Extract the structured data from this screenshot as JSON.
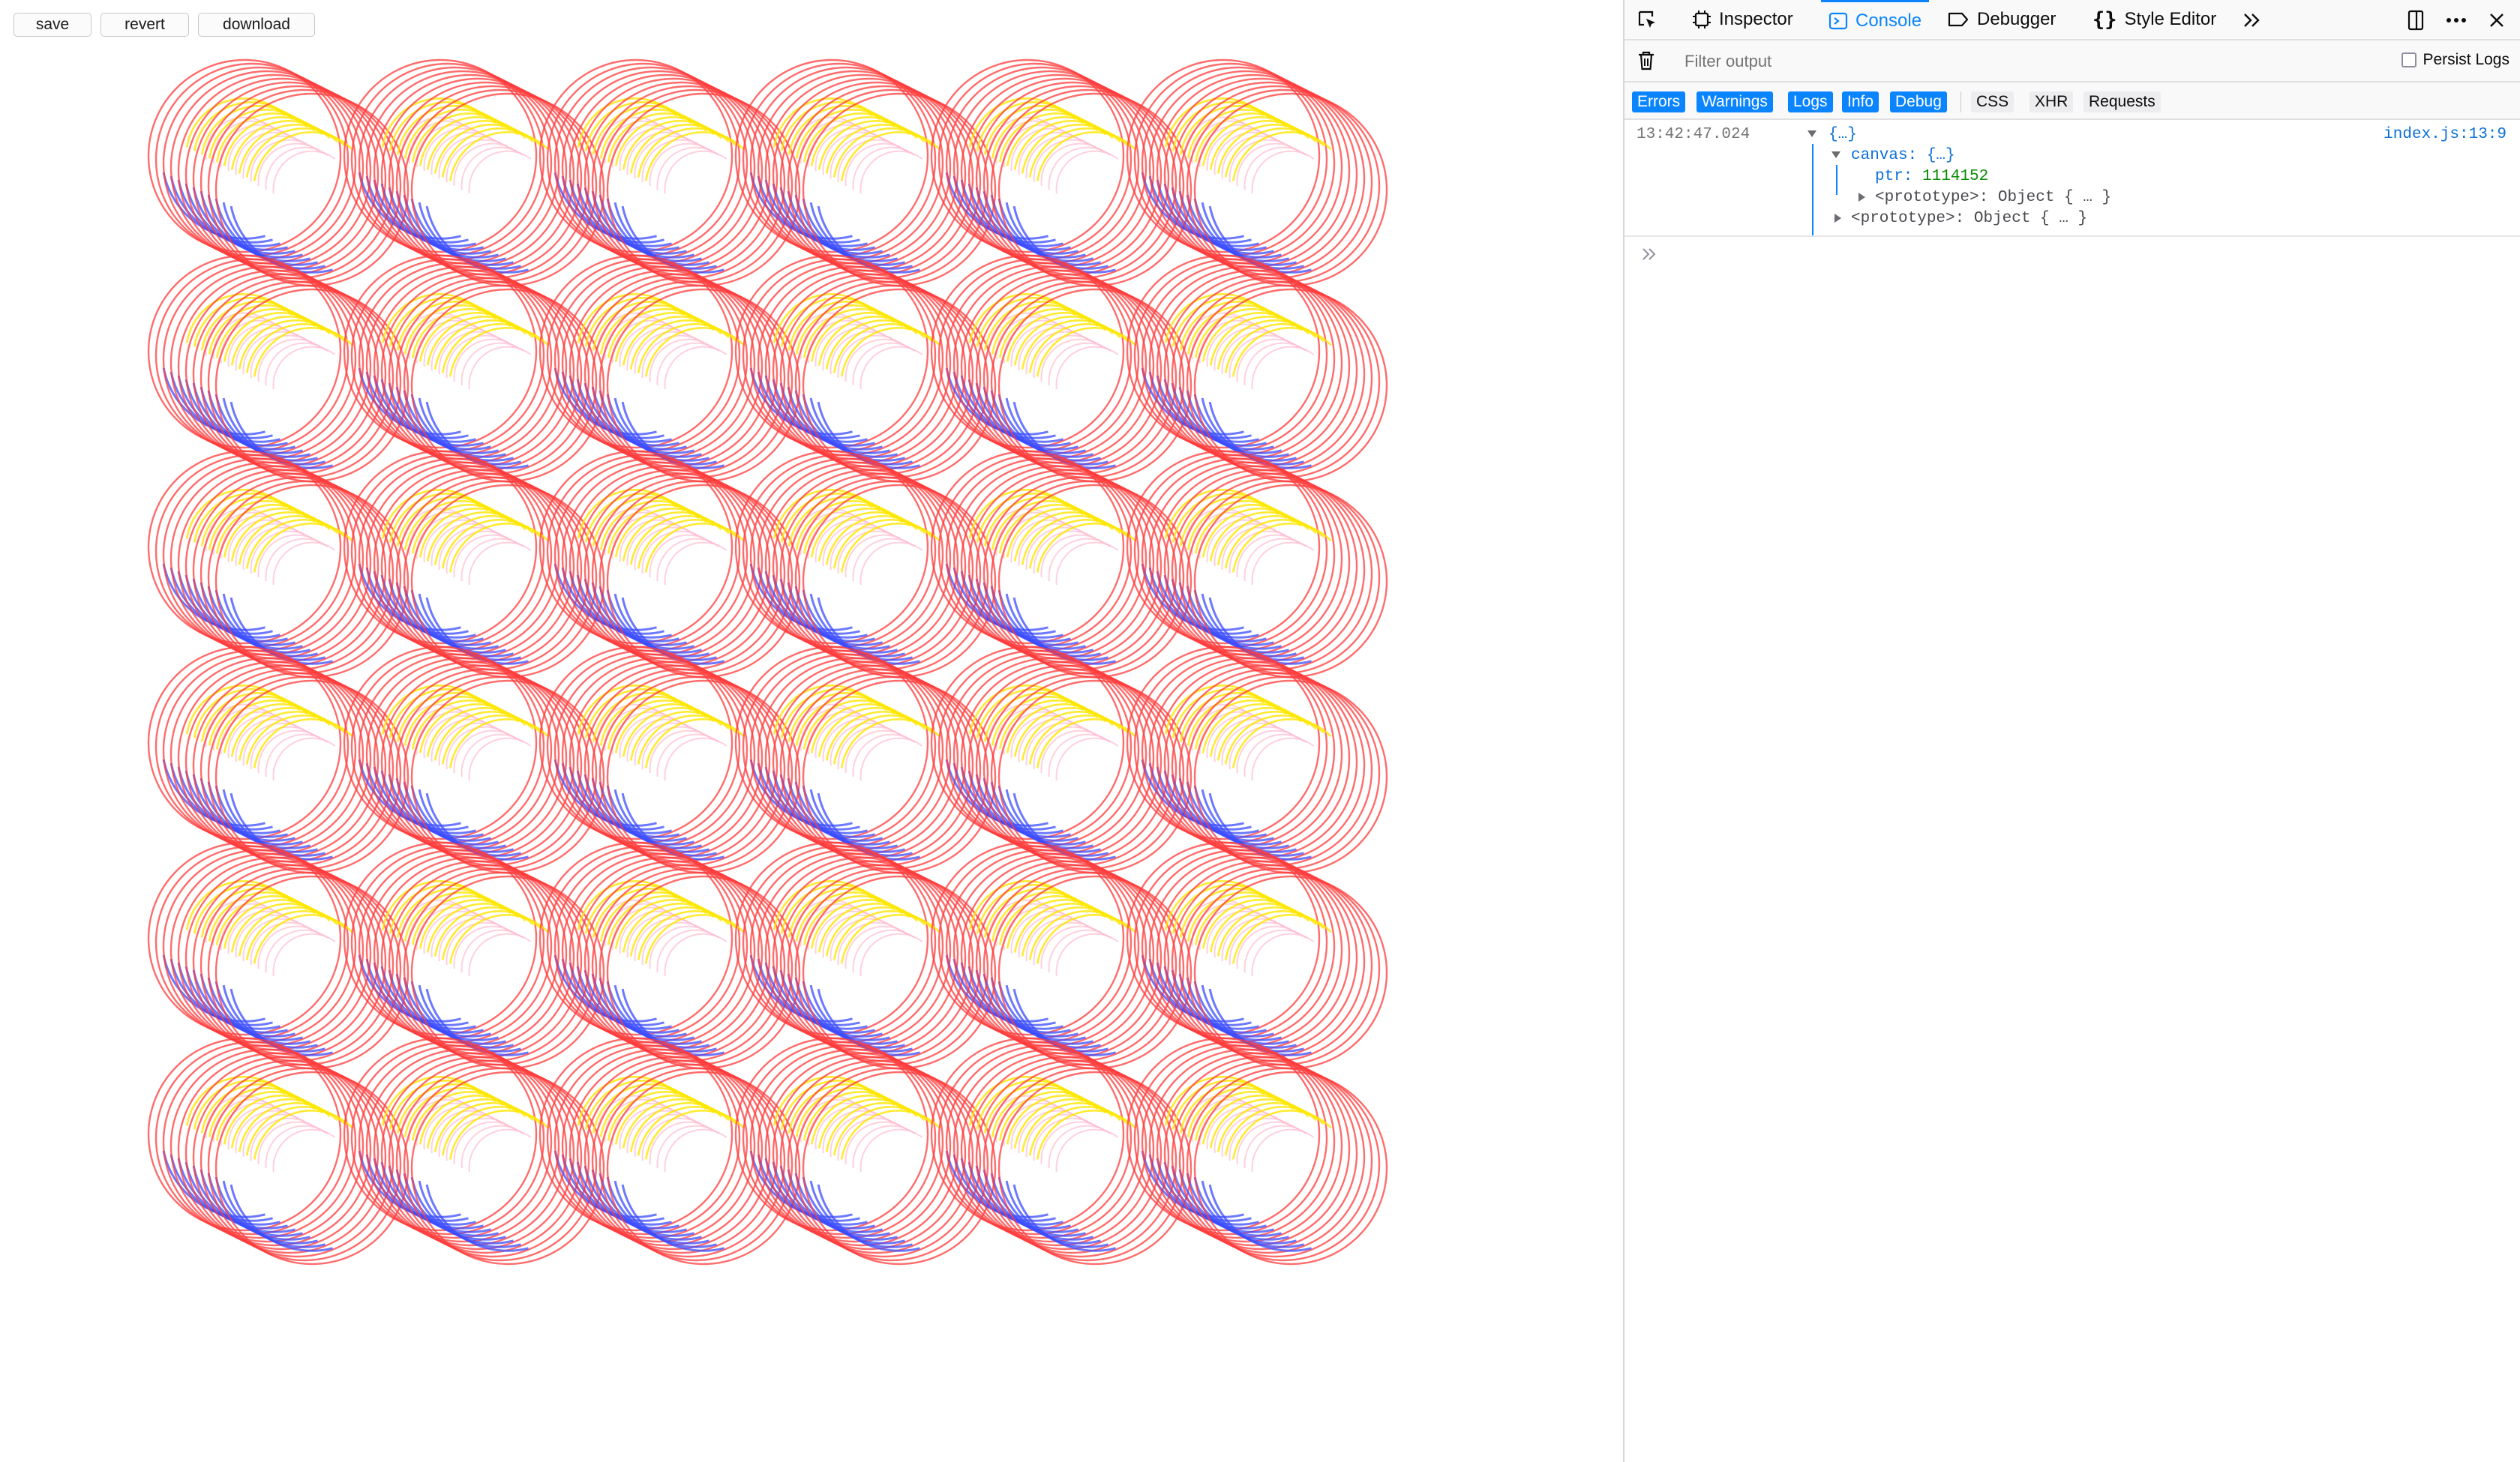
{
  "page": {
    "buttons": {
      "save": "save",
      "revert": "revert",
      "download": "download"
    },
    "artwork": {
      "grid_rows": 6,
      "grid_cols": 6,
      "rings_per_tile": 10,
      "colors": {
        "ring": "#ff3b3b",
        "arc_blue": "#3b4cff",
        "arc_yellow": "#ffe600",
        "arc_pink": "#ffb0c8"
      }
    }
  },
  "devtools": {
    "tabs": [
      {
        "label": "Inspector",
        "icon": "inspector-icon"
      },
      {
        "label": "Console",
        "icon": "console-icon"
      },
      {
        "label": "Debugger",
        "icon": "debugger-icon"
      },
      {
        "label": "Style Editor",
        "icon": "style-editor-icon"
      }
    ],
    "filter": {
      "placeholder": "Filter output",
      "persist_logs": "Persist Logs"
    },
    "levels": [
      "Errors",
      "Warnings",
      "Logs",
      "Info",
      "Debug"
    ],
    "types": [
      "CSS",
      "XHR",
      "Requests"
    ],
    "log": {
      "timestamp": "13:42:47.024",
      "source": "index.js:13:9",
      "root_preview": "{…}",
      "canvas_key": "canvas:",
      "canvas_preview": "{…}",
      "ptr_key": "ptr:",
      "ptr_value": "1114152",
      "prototype_key": "<prototype>:",
      "prototype_value": "Object { … }"
    },
    "colors": {
      "accent": "#0a84ff",
      "number": "#058b00"
    }
  }
}
